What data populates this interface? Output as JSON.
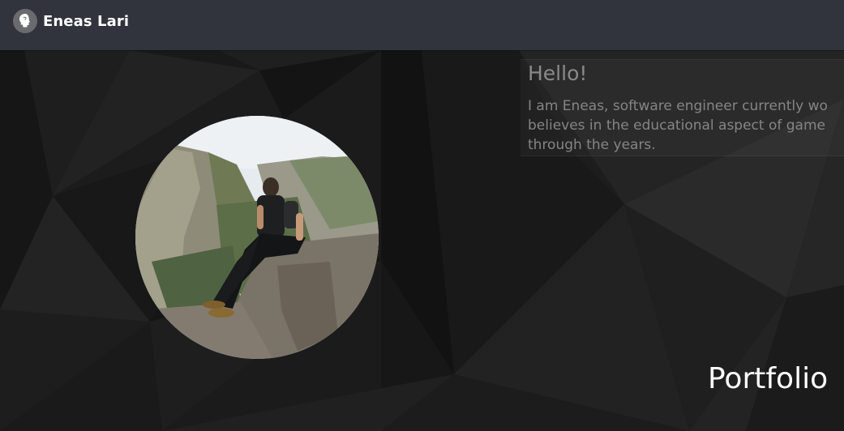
{
  "navbar": {
    "brand_name": "Eneas Lari",
    "brand_icon": "head-silhouette-icon"
  },
  "about": {
    "title": "Hello!",
    "lines": [
      "I am Eneas, software engineer currently wo",
      "believes in the educational aspect of game",
      "through the years."
    ]
  },
  "avatar": {
    "description_icon": "profile-photo"
  },
  "section": {
    "portfolio_heading": "Portfolio"
  },
  "colors": {
    "navbar_bg": "#31343c",
    "page_bg": "#1a1a1a",
    "text_primary": "#ffffff",
    "text_muted": "#858585"
  }
}
